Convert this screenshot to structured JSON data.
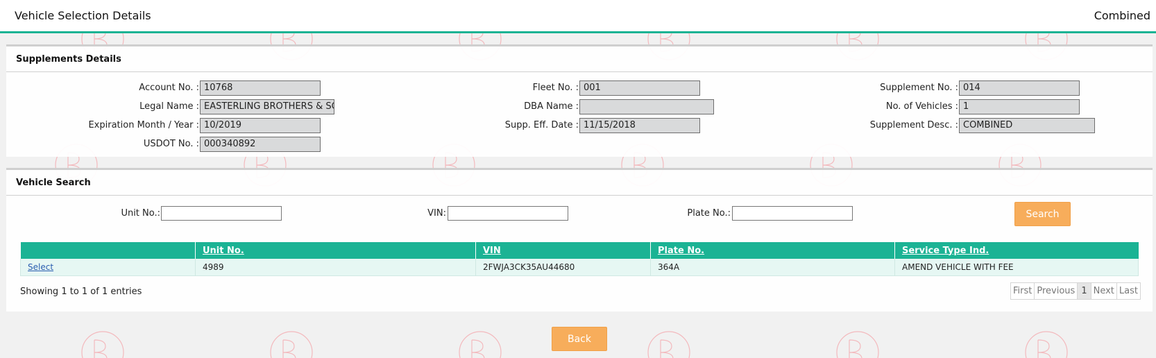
{
  "header": {
    "title": "Vehicle Selection Details",
    "mode": "Combined"
  },
  "supplements": {
    "section_title": "Supplements Details",
    "account_no": {
      "label": "Account No. :",
      "value": "10768"
    },
    "legal_name": {
      "label": "Legal Name :",
      "value": "EASTERLING BROTHERS & SON"
    },
    "expiration": {
      "label": "Expiration Month / Year :",
      "value": "10/2019"
    },
    "usdot_no": {
      "label": "USDOT No. :",
      "value": "000340892"
    },
    "fleet_no": {
      "label": "Fleet No. :",
      "value": "001"
    },
    "dba_name": {
      "label": "DBA Name :",
      "value": ""
    },
    "supp_eff_date": {
      "label": "Supp. Eff. Date :",
      "value": "11/15/2018"
    },
    "supplement_no": {
      "label": "Supplement No. :",
      "value": "014"
    },
    "no_of_vehicles": {
      "label": "No. of Vehicles :",
      "value": "1"
    },
    "supplement_desc": {
      "label": "Supplement Desc. :",
      "value": "COMBINED"
    }
  },
  "vehicle_search": {
    "section_title": "Vehicle Search",
    "unit_no_label": "Unit No.:",
    "unit_no_value": "",
    "vin_label": "VIN:",
    "vin_value": "",
    "plate_no_label": "Plate No.:",
    "plate_no_value": "",
    "search_label": "Search"
  },
  "table": {
    "columns": [
      "",
      "Unit No.",
      "VIN",
      "Plate No.",
      "Service Type Ind."
    ],
    "rows": [
      {
        "action": "Select",
        "unit_no": "4989",
        "vin": "2FWJA3CK35AU44680",
        "plate_no": "364A",
        "service_type": "AMEND VEHICLE WITH FEE"
      }
    ],
    "info": "Showing 1 to 1 of 1 entries"
  },
  "pagination": {
    "first": "First",
    "previous": "Previous",
    "current": "1",
    "next": "Next",
    "last": "Last"
  },
  "footer": {
    "back_label": "Back"
  },
  "colors": {
    "accent": "#1bb394",
    "button": "#f7ad5b",
    "readonly_bg": "#d9dadb"
  }
}
